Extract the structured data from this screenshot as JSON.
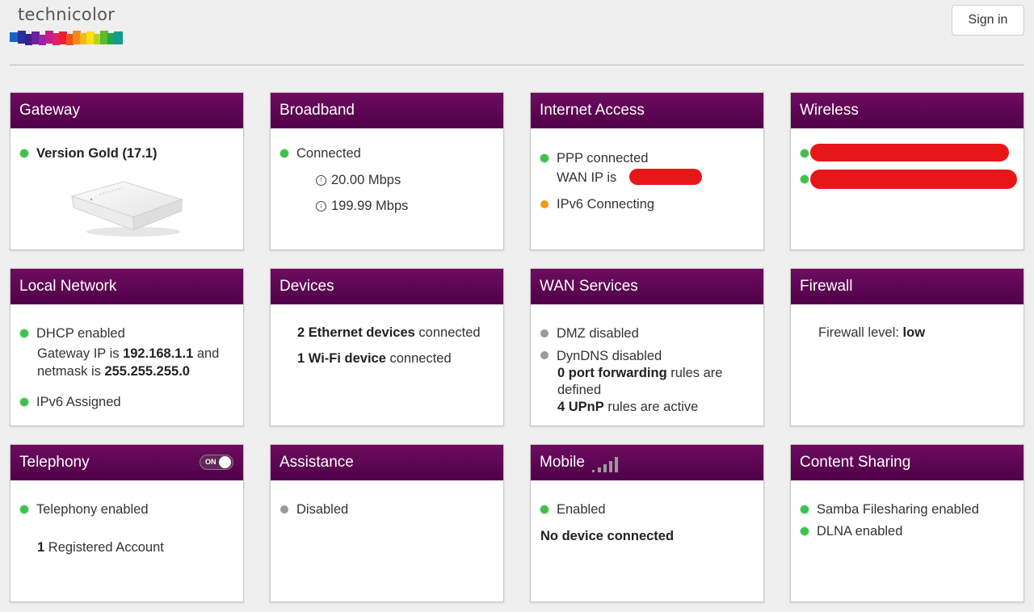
{
  "brand": {
    "name": "technicolor"
  },
  "header": {
    "signin_label": "Sign in"
  },
  "cards": {
    "gateway": {
      "title": "Gateway",
      "version": "Version Gold (17.1)"
    },
    "broadband": {
      "title": "Broadband",
      "status": "Connected",
      "upload": "20.00 Mbps",
      "download": "199.99 Mbps"
    },
    "internet": {
      "title": "Internet Access",
      "ppp": "PPP connected",
      "wan_ip_label": "WAN IP is",
      "ipv6": "IPv6 Connecting"
    },
    "wireless": {
      "title": "Wireless"
    },
    "local_network": {
      "title": "Local Network",
      "dhcp": "DHCP enabled",
      "gw_prefix": "Gateway IP is ",
      "gw_ip": "192.168.1.1",
      "gw_and": " and",
      "netmask_prefix": "netmask is ",
      "netmask": "255.255.255.0",
      "ipv6": "IPv6 Assigned"
    },
    "devices": {
      "title": "Devices",
      "ethernet_bold": "2 Ethernet devices",
      "ethernet_rest": " connected",
      "wifi_bold": "1 Wi-Fi device",
      "wifi_rest": " connected"
    },
    "wan_services": {
      "title": "WAN Services",
      "dmz": "DMZ disabled",
      "dyndns": "DynDNS disabled",
      "pf_bold": "0 port forwarding",
      "pf_rest": " rules are",
      "pf_line2": "defined",
      "upnp_bold": "4 UPnP",
      "upnp_rest": " rules are active"
    },
    "firewall": {
      "title": "Firewall",
      "level_label": "Firewall level: ",
      "level": "low"
    },
    "telephony": {
      "title": "Telephony",
      "toggle": "ON",
      "status": "Telephony enabled",
      "accounts_count": "1",
      "accounts_label": " Registered Account"
    },
    "assistance": {
      "title": "Assistance",
      "status": "Disabled"
    },
    "mobile": {
      "title": "Mobile",
      "status": "Enabled",
      "device": "No device connected"
    },
    "content_sharing": {
      "title": "Content Sharing",
      "samba": "Samba Filesharing enabled",
      "dlna": "DLNA enabled"
    }
  },
  "colors": {
    "header_purple": "#5e0355",
    "status_green": "#3ec04d",
    "status_orange": "#f39a14",
    "status_gray": "#9a9a9a",
    "redaction_red": "#e81717"
  }
}
